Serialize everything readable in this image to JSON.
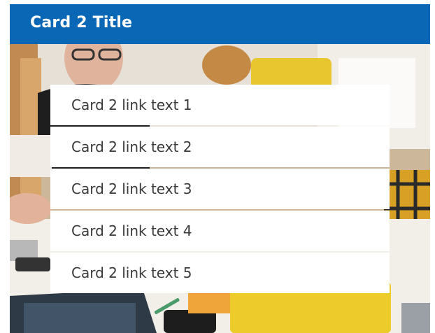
{
  "card": {
    "title": "Card 2 Title",
    "header_color": "#0a67b5",
    "links": [
      {
        "label": "Card 2 link text 1"
      },
      {
        "label": "Card 2 link text 2"
      },
      {
        "label": "Card 2 link text 3"
      },
      {
        "label": "Card 2 link text 4"
      },
      {
        "label": "Card 2 link text 5"
      }
    ]
  }
}
